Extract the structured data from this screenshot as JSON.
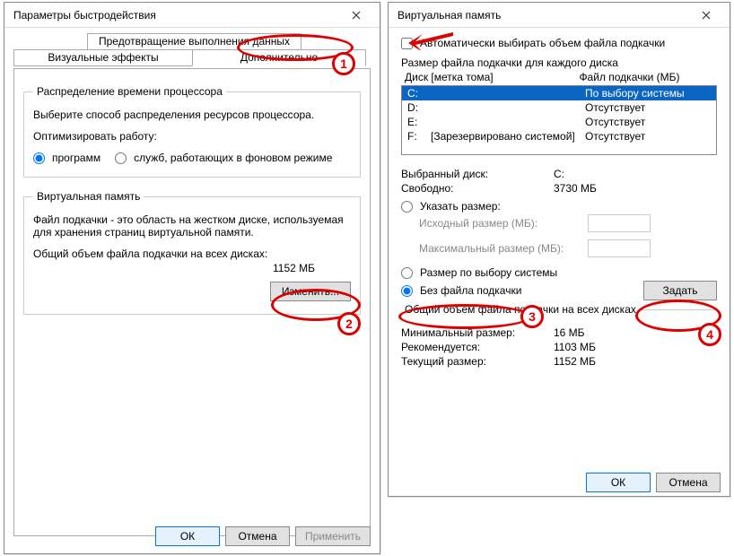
{
  "left": {
    "title": "Параметры быстродействия",
    "tabs": {
      "dep": "Предотвращение выполнения данных",
      "visual": "Визуальные эффекты",
      "advanced": "Дополнительно"
    },
    "cpu_group": {
      "legend": "Распределение времени процессора",
      "desc": "Выберите способ распределения ресурсов процессора.",
      "opt_label": "Оптимизировать работу:",
      "opt_programs": "программ",
      "opt_services": "служб, работающих в фоновом режиме"
    },
    "vm_group": {
      "legend": "Виртуальная память",
      "desc": "Файл подкачки - это область на жестком диске, используемая для хранения страниц виртуальной памяти.",
      "total_label": "Общий объем файла подкачки на всех дисках:",
      "total_value": "1152 МБ",
      "change_btn": "Изменить..."
    },
    "footer": {
      "ok": "ОК",
      "cancel": "Отмена",
      "apply": "Применить"
    }
  },
  "right": {
    "title": "Виртуальная память",
    "auto_label": "Автоматически выбирать объем файла подкачки",
    "list_label": "Размер файла подкачки для каждого диска",
    "headers": {
      "disk": "Диск [метка тома]",
      "file": "Файл подкачки (МБ)"
    },
    "disks": [
      {
        "letter": "C:",
        "label": "",
        "file": "По выбору системы",
        "selected": true
      },
      {
        "letter": "D:",
        "label": "",
        "file": "Отсутствует",
        "selected": false
      },
      {
        "letter": "E:",
        "label": "",
        "file": "Отсутствует",
        "selected": false
      },
      {
        "letter": "F:",
        "label": "[Зарезервировано системой]",
        "file": "Отсутствует",
        "selected": false
      }
    ],
    "selected": {
      "disk_label": "Выбранный диск:",
      "disk_value": "C:",
      "free_label": "Свободно:",
      "free_value": "3730 МБ"
    },
    "opts": {
      "custom": "Указать размер:",
      "init": "Исходный размер (МБ):",
      "max": "Максимальный размер (МБ):",
      "system": "Размер по выбору системы",
      "none": "Без файла подкачки",
      "set_btn": "Задать"
    },
    "totals": {
      "legend": "Общий объем файла подкачки на всех дисках",
      "min_label": "Минимальный размер:",
      "min_value": "16 МБ",
      "rec_label": "Рекомендуется:",
      "rec_value": "1103 МБ",
      "cur_label": "Текущий размер:",
      "cur_value": "1152 МБ"
    },
    "footer": {
      "ok": "ОК",
      "cancel": "Отмена"
    }
  },
  "ann": {
    "n1": "1",
    "n2": "2",
    "n3": "3",
    "n4": "4"
  }
}
